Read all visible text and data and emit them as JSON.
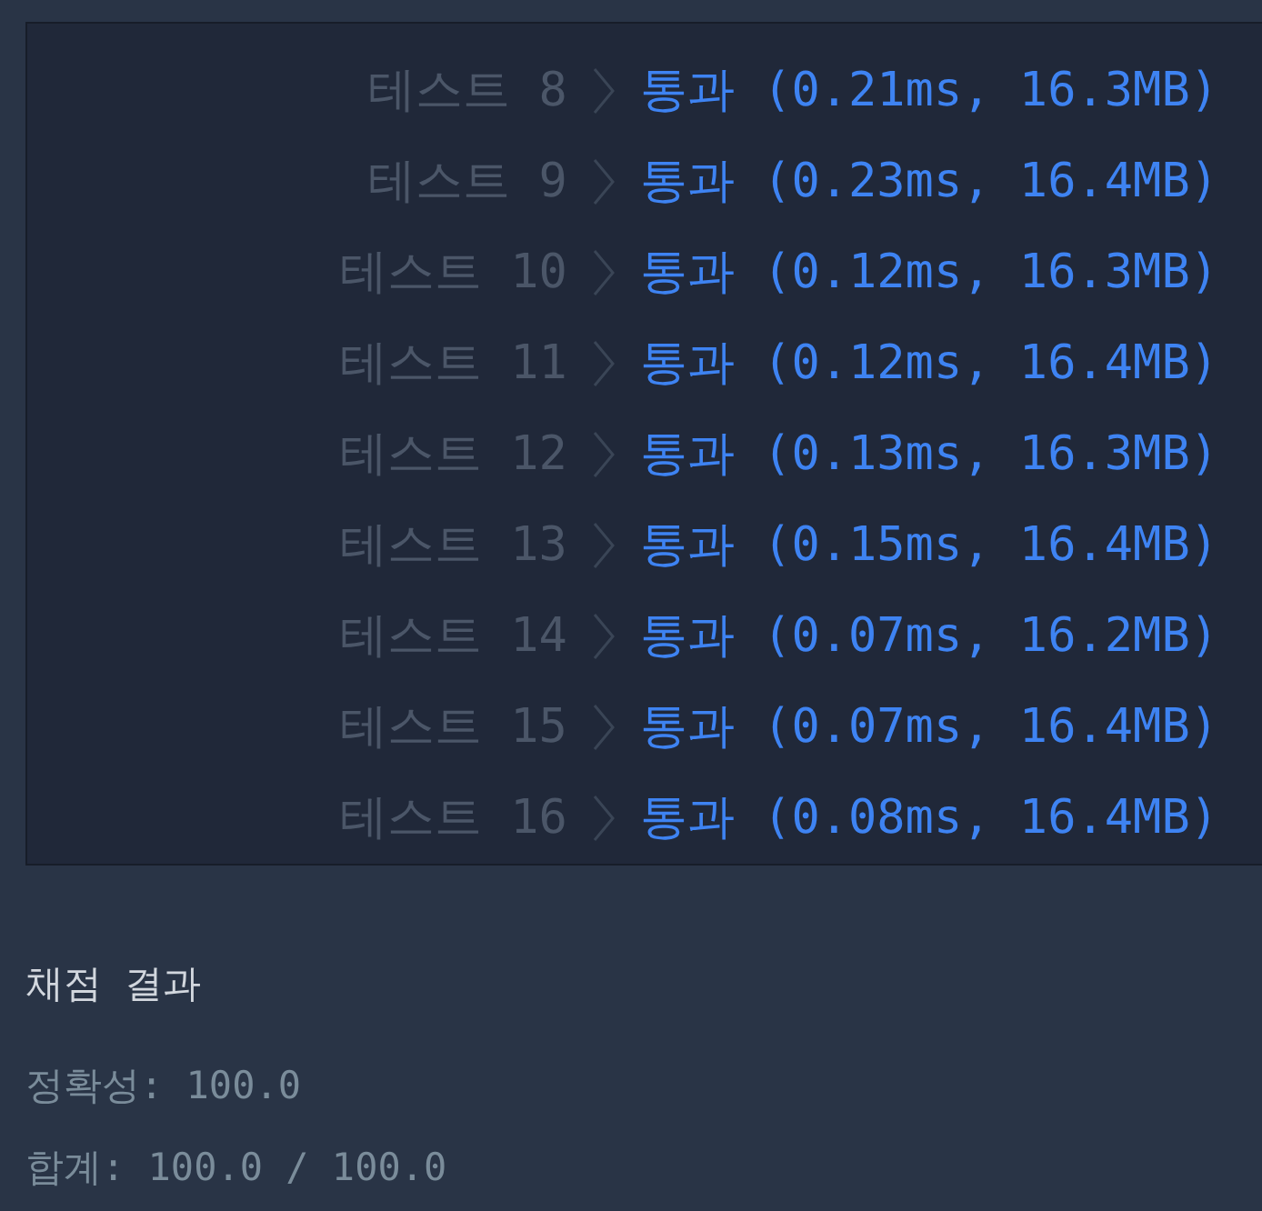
{
  "tests": [
    {
      "label": "테스트 8",
      "result": "통과 (0.21ms, 16.3MB)"
    },
    {
      "label": "테스트 9",
      "result": "통과 (0.23ms, 16.4MB)"
    },
    {
      "label": "테스트 10",
      "result": "통과 (0.12ms, 16.3MB)"
    },
    {
      "label": "테스트 11",
      "result": "통과 (0.12ms, 16.4MB)"
    },
    {
      "label": "테스트 12",
      "result": "통과 (0.13ms, 16.3MB)"
    },
    {
      "label": "테스트 13",
      "result": "통과 (0.15ms, 16.4MB)"
    },
    {
      "label": "테스트 14",
      "result": "통과 (0.07ms, 16.2MB)"
    },
    {
      "label": "테스트 15",
      "result": "통과 (0.07ms, 16.4MB)"
    },
    {
      "label": "테스트 16",
      "result": "통과 (0.08ms, 16.4MB)"
    }
  ],
  "summary": {
    "title": "채점 결과",
    "accuracy": "정확성: 100.0",
    "total": "합계: 100.0 / 100.0"
  }
}
